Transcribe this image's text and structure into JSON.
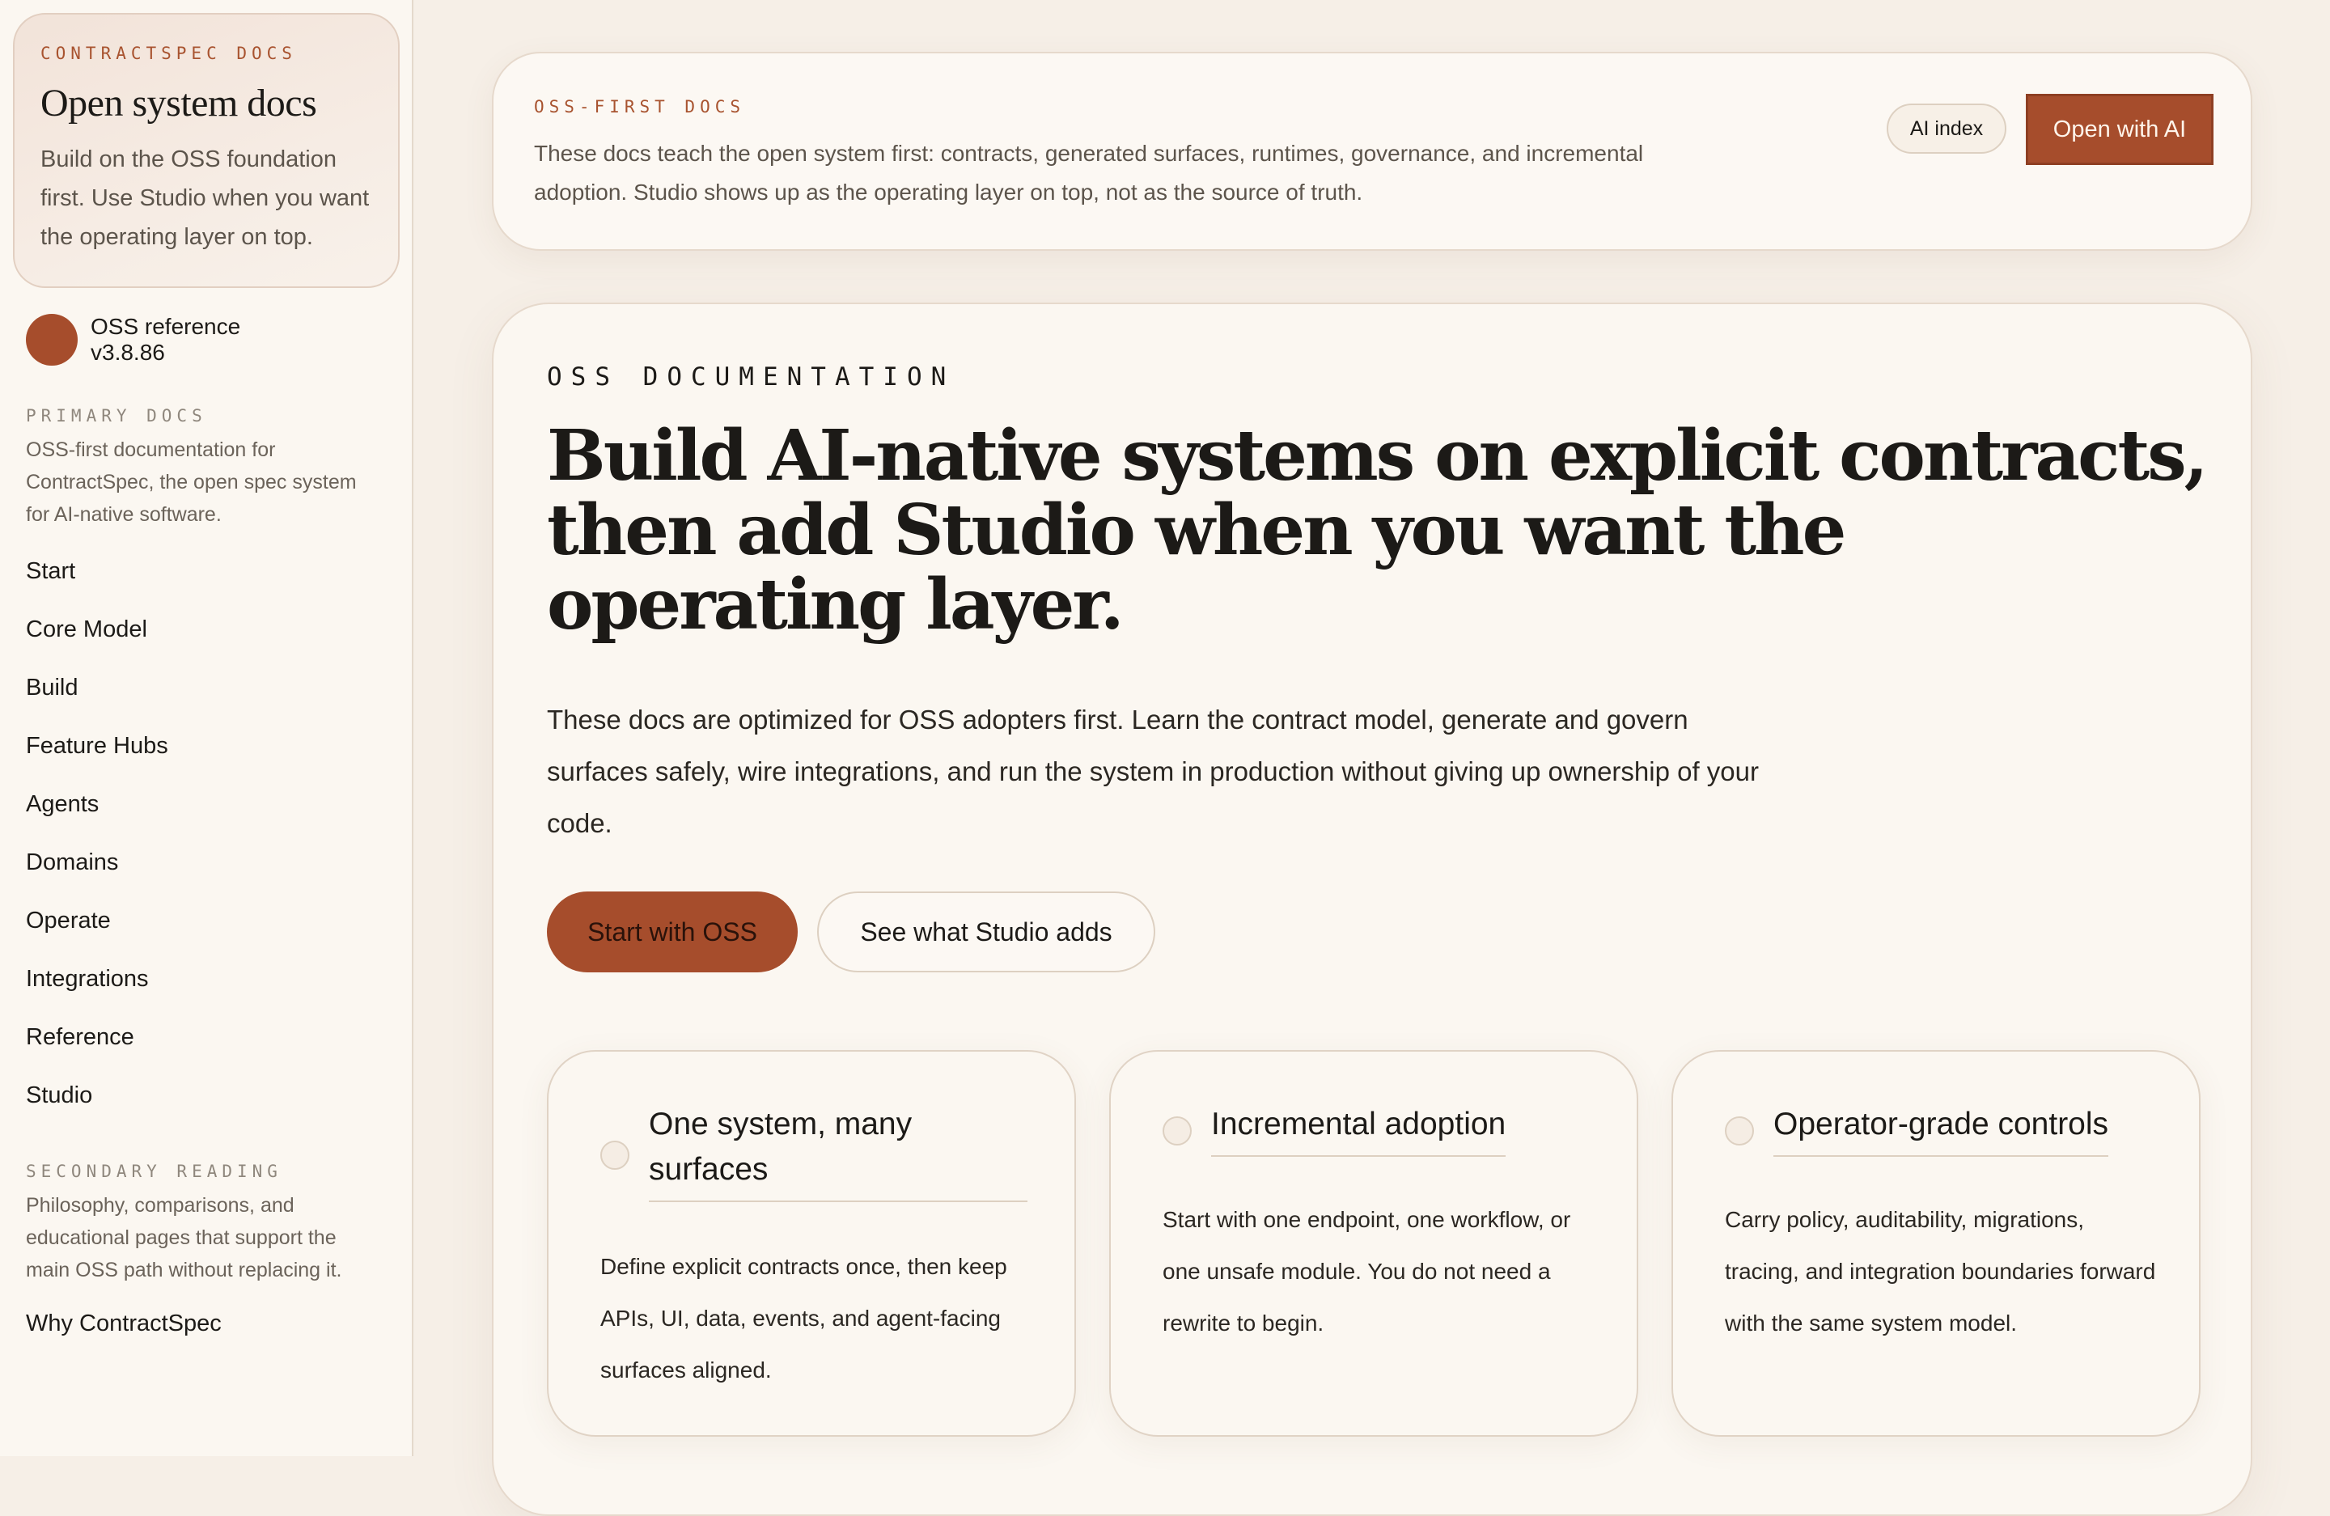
{
  "sidebar": {
    "brand": {
      "eyebrow": "CONTRACTSPEC DOCS",
      "title": "Open system docs",
      "description": "Build on the OSS foundation first. Use Studio when you want the operating layer on top."
    },
    "version": {
      "label": "OSS reference",
      "number": "v3.8.86"
    },
    "primary": {
      "label": "PRIMARY DOCS",
      "description": "OSS-first documentation for ContractSpec, the open spec system for AI-native software.",
      "items": [
        "Start",
        "Core Model",
        "Build",
        "Feature Hubs",
        "Agents",
        "Domains",
        "Operate",
        "Integrations",
        "Reference",
        "Studio"
      ]
    },
    "secondary": {
      "label": "SECONDARY READING",
      "description": "Philosophy, comparisons, and educational pages that support the main OSS path without replacing it.",
      "items": [
        "Why ContractSpec"
      ]
    }
  },
  "banner": {
    "eyebrow": "OSS-FIRST DOCS",
    "text": "These docs teach the open system first: contracts, generated surfaces, runtimes, governance, and incremental adoption. Studio shows up as the operating layer on top, not as the source of truth.",
    "ai_index_label": "AI index",
    "open_ai_label": "Open with AI"
  },
  "main": {
    "eyebrow": "OSS DOCUMENTATION",
    "title": "Build AI-native systems on explicit contracts, then add Studio when you want the operating layer.",
    "description": "These docs are optimized for OSS adopters first. Learn the contract model, generate and govern surfaces safely, wire integrations, and run the system in production without giving up ownership of your code.",
    "primary_cta": "Start with OSS",
    "secondary_cta": "See what Studio adds",
    "features": [
      {
        "title": "One system, many surfaces",
        "text": "Define explicit contracts once, then keep APIs, UI, data, events, and agent-facing surfaces aligned."
      },
      {
        "title": "Incremental adoption",
        "text": "Start with one endpoint, one workflow, or one unsafe module. You do not need a rewrite to begin."
      },
      {
        "title": "Operator-grade controls",
        "text": "Carry policy, auditability, migrations, tracing, and integration boundaries forward with the same system model."
      }
    ]
  },
  "colors": {
    "accent": "#a64d2c",
    "background": "#f6efe7",
    "surface": "#fbf7f1",
    "eyebrow": "#a8532f"
  }
}
